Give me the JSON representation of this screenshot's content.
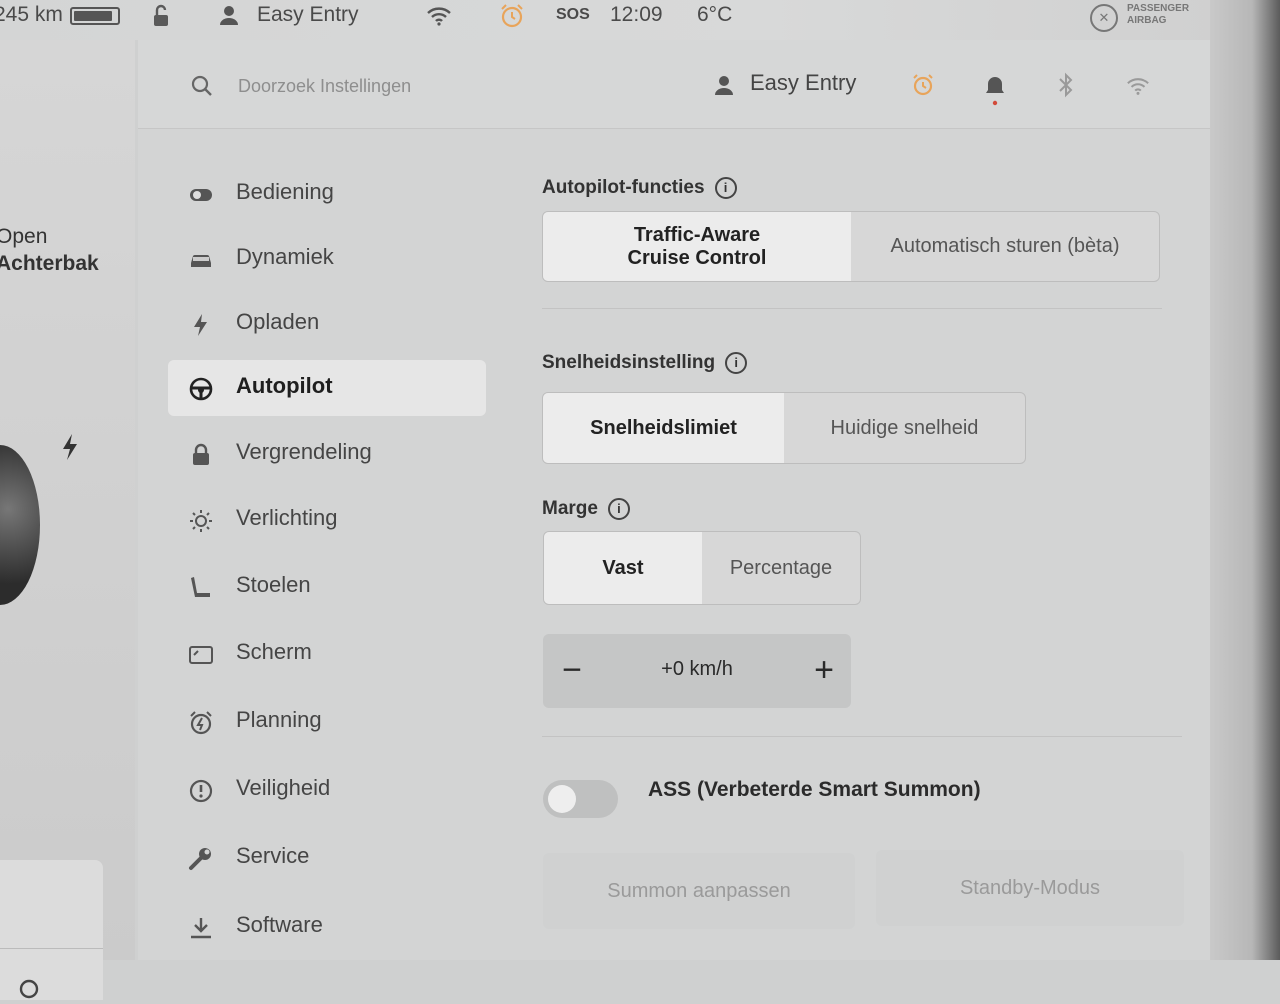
{
  "status_bar": {
    "range": "245 km",
    "battery_level": 0.9,
    "profile": "Easy Entry",
    "sos": "SOS",
    "time": "12:09",
    "temperature": "6°C",
    "airbag_line1": "PASSENGER",
    "airbag_line2": "AIRBAG"
  },
  "left_panel": {
    "trunk_line1": "Open",
    "trunk_line2": "Achterbak"
  },
  "header": {
    "search_placeholder": "Doorzoek Instellingen",
    "profile": "Easy Entry"
  },
  "nav": {
    "items": [
      {
        "label": "Bediening",
        "icon": "toggle-icon"
      },
      {
        "label": "Dynamiek",
        "icon": "car-icon"
      },
      {
        "label": "Opladen",
        "icon": "lightning-icon"
      },
      {
        "label": "Autopilot",
        "icon": "steering-wheel-icon",
        "active": true
      },
      {
        "label": "Vergrendeling",
        "icon": "lock-icon"
      },
      {
        "label": "Verlichting",
        "icon": "sun-icon"
      },
      {
        "label": "Stoelen",
        "icon": "seat-icon"
      },
      {
        "label": "Scherm",
        "icon": "display-icon"
      },
      {
        "label": "Planning",
        "icon": "alarm-icon"
      },
      {
        "label": "Veiligheid",
        "icon": "alert-circle-icon"
      },
      {
        "label": "Service",
        "icon": "wrench-icon"
      },
      {
        "label": "Software",
        "icon": "download-icon"
      }
    ]
  },
  "autopilot_features": {
    "title": "Autopilot-functies",
    "option1_line1": "Traffic-Aware",
    "option1_line2": "Cruise Control",
    "option2": "Automatisch sturen (bèta)"
  },
  "speed_setting": {
    "title": "Snelheidsinstelling",
    "option1": "Snelheidslimiet",
    "option2": "Huidige snelheid"
  },
  "margin": {
    "title": "Marge",
    "option1": "Vast",
    "option2": "Percentage",
    "value": "+0 km/h",
    "minus": "−",
    "plus": "+"
  },
  "ass": {
    "label": "ASS (Verbeterde Smart Summon)",
    "enabled": false
  },
  "buttons": {
    "summon": "Summon aanpassen",
    "standby": "Standby-Modus"
  },
  "colors": {
    "alarm_accent": "#e8a45a",
    "notification_dot": "#d24a3a"
  }
}
